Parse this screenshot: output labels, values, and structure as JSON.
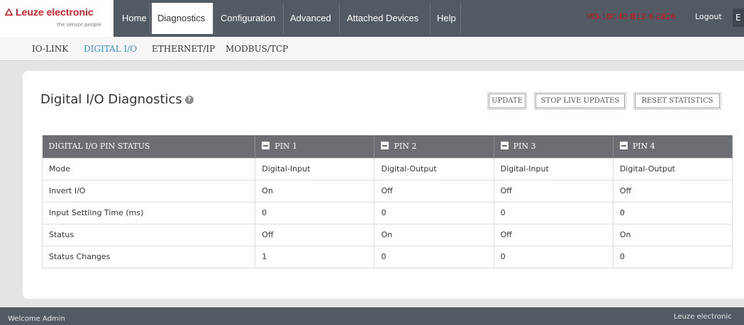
{
  "brand": {
    "name_red": "Leuze electronic",
    "tagline": "the sensor people"
  },
  "nav": {
    "tabs": [
      {
        "label": "Home"
      },
      {
        "label": "Diagnostics"
      },
      {
        "label": "Configuration"
      },
      {
        "label": "Advanced"
      },
      {
        "label": "Attached Devices"
      },
      {
        "label": "Help"
      }
    ],
    "device_name": "MD-100-IO-B12-K-2826",
    "logout": "Logout",
    "lang": "E"
  },
  "subnav": {
    "items": [
      {
        "label": "IO-LINK"
      },
      {
        "label": "DIGITAL I/O"
      },
      {
        "label": "ETHERNET/IP"
      },
      {
        "label": "MODBUS/TCP"
      }
    ]
  },
  "panel": {
    "title": "Digital I/O Diagnostics",
    "buttons": {
      "update": "UPDATE",
      "stop": "STOP LIVE UPDATES",
      "reset": "RESET STATISTICS"
    }
  },
  "table": {
    "header": [
      "DIGITAL I/O PIN STATUS",
      "PIN 1",
      "PIN 2",
      "PIN 3",
      "PIN 4"
    ],
    "rows": [
      [
        "Mode",
        "Digital-Input",
        "Digital-Output",
        "Digital-Input",
        "Digital-Output"
      ],
      [
        "Invert I/O",
        "On",
        "Off",
        "Off",
        "Off"
      ],
      [
        "Input Settling Time (ms)",
        "0",
        "0",
        "0",
        "0"
      ],
      [
        "Status",
        "Off",
        "On",
        "Off",
        "On"
      ],
      [
        "Status Changes",
        "1",
        "0",
        "0",
        "0"
      ]
    ]
  },
  "footer": {
    "welcome": "Welcome Admin",
    "brand": "Leuze electronic"
  },
  "colors": {
    "nav_bg": "#525a63",
    "brand_red": "#d41f2b",
    "active_subnav": "#3a8fbd",
    "table_header": "#6b6f74"
  },
  "icons": [
    "leuze-logo-triangle-icon",
    "help-icon",
    "collapse-minus-icon"
  ]
}
